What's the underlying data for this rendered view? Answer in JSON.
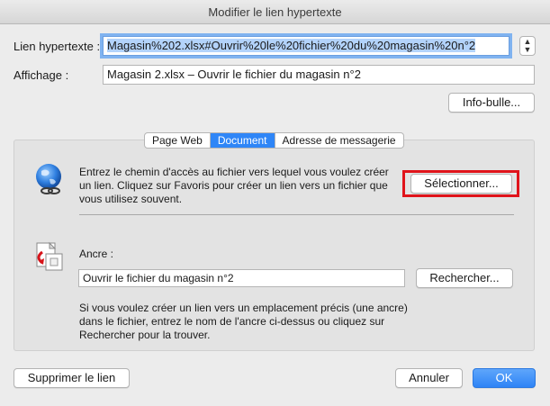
{
  "window": {
    "title": "Modifier le lien hypertexte"
  },
  "link": {
    "label": "Lien hypertexte :",
    "value": "Magasin%202.xlsx#Ouvrir%20le%20fichier%20du%20magasin%20n°2"
  },
  "display": {
    "label": "Affichage :",
    "value": "Magasin 2.xlsx – Ouvrir le fichier du magasin n°2"
  },
  "tooltip_button": "Info-bulle...",
  "tabs": [
    {
      "label": "Page Web",
      "active": false
    },
    {
      "label": "Document",
      "active": true
    },
    {
      "label": "Adresse de messagerie",
      "active": false
    }
  ],
  "document": {
    "instructions": "Entrez le chemin d'accès au fichier vers lequel vous voulez créer un lien. Cliquez sur Favoris pour créer un lien vers un fichier que vous utilisez souvent.",
    "select_button": "Sélectionner...",
    "anchor_label": "Ancre :",
    "anchor_value": "Ouvrir le fichier du magasin n°2",
    "search_button": "Rechercher...",
    "anchor_help": "Si vous voulez créer un lien vers un emplacement précis (une ancre) dans le fichier, entrez le nom de l'ancre ci-dessus ou cliquez sur Rechercher pour la trouver."
  },
  "footer": {
    "remove_link": "Supprimer le lien",
    "cancel": "Annuler",
    "ok": "OK"
  },
  "colors": {
    "accent": "#2f86f7",
    "highlight": "#e0141b"
  },
  "icons": {
    "document": "globe-link-icon",
    "anchor": "anchor-file-icon",
    "stepper": "stepper-icon"
  }
}
